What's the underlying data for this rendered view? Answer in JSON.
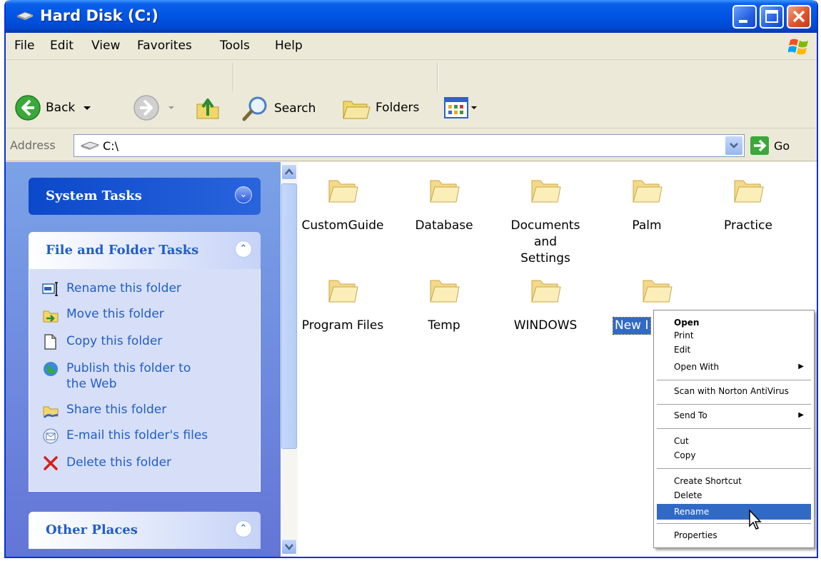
{
  "window": {
    "title": "Hard Disk (C:)"
  },
  "menu": [
    "File",
    "Edit",
    "View",
    "Favorites",
    "Tools",
    "Help"
  ],
  "toolbar": {
    "back": "Back",
    "search": "Search",
    "folders": "Folders"
  },
  "address": {
    "label": "Address",
    "value": "C:\\",
    "go": "Go"
  },
  "task_pane": {
    "system_tasks": {
      "title": "System Tasks"
    },
    "file_folder_tasks": {
      "title": "File and Folder Tasks",
      "items": [
        {
          "label": "Rename this folder",
          "icon": "rename-icon"
        },
        {
          "label": "Move this folder",
          "icon": "move-icon"
        },
        {
          "label": "Copy this folder",
          "icon": "copy-icon"
        },
        {
          "label": "Publish this folder to the Web",
          "icon": "publish-web-icon"
        },
        {
          "label": "Share this folder",
          "icon": "share-icon"
        },
        {
          "label": "E-mail this folder's files",
          "icon": "email-icon"
        },
        {
          "label": "Delete this folder",
          "icon": "delete-icon"
        }
      ]
    },
    "other_places": {
      "title": "Other Places"
    }
  },
  "files": [
    {
      "name": "CustomGuide"
    },
    {
      "name": "Database"
    },
    {
      "name": "Documents and Settings"
    },
    {
      "name": "Palm"
    },
    {
      "name": "Practice"
    },
    {
      "name": "Program Files"
    },
    {
      "name": "Temp"
    },
    {
      "name": "WINDOWS"
    },
    {
      "name": "New Folder",
      "visible_label": "New I",
      "selected": true
    }
  ],
  "context_menu": {
    "items": [
      {
        "label": "Open",
        "bold": true
      },
      {
        "label": "Print"
      },
      {
        "label": "Edit"
      },
      {
        "label": "Open With",
        "submenu": true
      },
      {
        "label": "Scan with Norton AntiVirus"
      },
      {
        "label": "Send To",
        "submenu": true
      },
      {
        "label": "Cut"
      },
      {
        "label": "Copy"
      },
      {
        "label": "Create Shortcut"
      },
      {
        "label": "Delete"
      },
      {
        "label": "Rename",
        "highlighted": true
      },
      {
        "label": "Properties"
      }
    ]
  },
  "colors": {
    "title_blue": "#0054e3",
    "highlight": "#316ac5",
    "task_link": "#215dc6",
    "folder": "#f7e7a4"
  }
}
